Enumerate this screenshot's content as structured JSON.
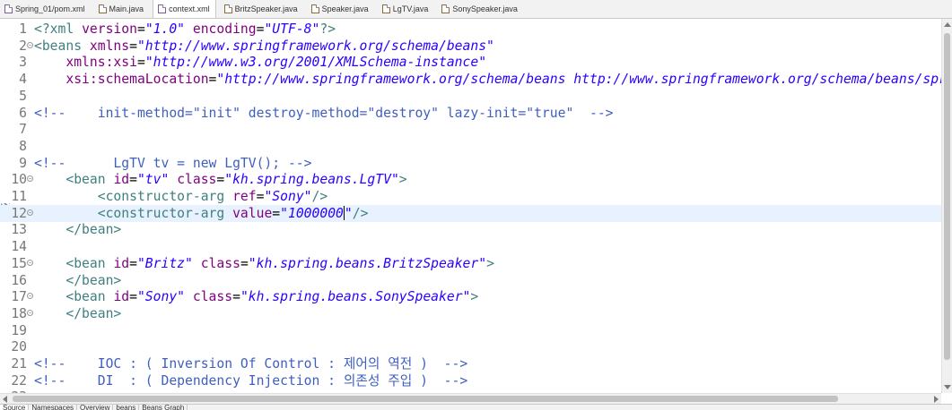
{
  "tabs": [
    {
      "label": "Spring_01/pom.xml",
      "type": "xml",
      "active": false
    },
    {
      "label": "Main.java",
      "type": "java",
      "active": false
    },
    {
      "label": "context.xml",
      "type": "xml",
      "active": true
    },
    {
      "label": "BritzSpeaker.java",
      "type": "java",
      "active": false
    },
    {
      "label": "Speaker.java",
      "type": "java",
      "active": false
    },
    {
      "label": "LgTV.java",
      "type": "java",
      "active": false
    },
    {
      "label": "SonySpeaker.java",
      "type": "java",
      "active": false
    }
  ],
  "editor": {
    "current_line": 12,
    "lines": [
      {
        "n": "1",
        "fold": false,
        "parts": [
          [
            "pi",
            "<?xml "
          ],
          [
            "attr",
            "version"
          ],
          [
            "plain",
            "="
          ],
          [
            "str",
            "\"1.0\""
          ],
          [
            "plain",
            " "
          ],
          [
            "attr",
            "encoding"
          ],
          [
            "plain",
            "="
          ],
          [
            "str",
            "\"UTF-8\""
          ],
          [
            "pi",
            "?>"
          ]
        ]
      },
      {
        "n": "2",
        "fold": true,
        "parts": [
          [
            "tag",
            "<beans "
          ],
          [
            "attr",
            "xmlns"
          ],
          [
            "plain",
            "="
          ],
          [
            "str",
            "\"http://www.springframework.org/schema/beans\""
          ]
        ]
      },
      {
        "n": "3",
        "fold": false,
        "parts": [
          [
            "plain",
            "    "
          ],
          [
            "attr",
            "xmlns:xsi"
          ],
          [
            "plain",
            "="
          ],
          [
            "str",
            "\"http://www.w3.org/2001/XMLSchema-instance\""
          ]
        ]
      },
      {
        "n": "4",
        "fold": false,
        "parts": [
          [
            "plain",
            "    "
          ],
          [
            "attr",
            "xsi:schemaLocation"
          ],
          [
            "plain",
            "="
          ],
          [
            "str",
            "\"http://www.springframework.org/schema/beans http://www.springframework.org/schema/beans/sprin"
          ]
        ]
      },
      {
        "n": "5",
        "fold": false,
        "parts": []
      },
      {
        "n": "6",
        "fold": false,
        "parts": [
          [
            "comment",
            "<!--    init-method=\"init\" destroy-method=\"destroy\" lazy-init=\"true\"  -->"
          ]
        ]
      },
      {
        "n": "7",
        "fold": false,
        "parts": []
      },
      {
        "n": "8",
        "fold": false,
        "parts": []
      },
      {
        "n": "9",
        "fold": false,
        "parts": [
          [
            "comment",
            "<!--      LgTV tv = new LgTV(); -->"
          ]
        ]
      },
      {
        "n": "10",
        "fold": true,
        "parts": [
          [
            "plain",
            "    "
          ],
          [
            "tag",
            "<bean "
          ],
          [
            "attr",
            "id"
          ],
          [
            "plain",
            "="
          ],
          [
            "str",
            "\"tv\""
          ],
          [
            "plain",
            " "
          ],
          [
            "attr",
            "class"
          ],
          [
            "plain",
            "="
          ],
          [
            "str",
            "\"kh.spring.beans.LgTV\""
          ],
          [
            "tag",
            ">"
          ]
        ]
      },
      {
        "n": "11",
        "fold": false,
        "parts": [
          [
            "plain",
            "        "
          ],
          [
            "tag",
            "<constructor-arg "
          ],
          [
            "attr",
            "ref"
          ],
          [
            "plain",
            "="
          ],
          [
            "str",
            "\"Sony\""
          ],
          [
            "tag",
            "/>"
          ]
        ]
      },
      {
        "n": "12",
        "fold": true,
        "parts": [
          [
            "plain",
            "        "
          ],
          [
            "tag",
            "<constructor-arg "
          ],
          [
            "attr",
            "value"
          ],
          [
            "plain",
            "="
          ],
          [
            "str",
            "\"1000000"
          ],
          [
            "caret",
            ""
          ],
          [
            "str",
            "\""
          ],
          [
            "tag",
            "/>"
          ]
        ]
      },
      {
        "n": "13",
        "fold": false,
        "parts": [
          [
            "plain",
            "    "
          ],
          [
            "tag",
            "</bean>"
          ]
        ]
      },
      {
        "n": "14",
        "fold": false,
        "parts": []
      },
      {
        "n": "15",
        "fold": true,
        "parts": [
          [
            "plain",
            "    "
          ],
          [
            "tag",
            "<bean "
          ],
          [
            "attr",
            "id"
          ],
          [
            "plain",
            "="
          ],
          [
            "str",
            "\"Britz\""
          ],
          [
            "plain",
            " "
          ],
          [
            "attr",
            "class"
          ],
          [
            "plain",
            "="
          ],
          [
            "str",
            "\"kh.spring.beans.BritzSpeaker\""
          ],
          [
            "tag",
            ">"
          ]
        ]
      },
      {
        "n": "16",
        "fold": false,
        "parts": [
          [
            "plain",
            "    "
          ],
          [
            "tag",
            "</bean>"
          ]
        ]
      },
      {
        "n": "17",
        "fold": true,
        "parts": [
          [
            "plain",
            "    "
          ],
          [
            "tag",
            "<bean "
          ],
          [
            "attr",
            "id"
          ],
          [
            "plain",
            "="
          ],
          [
            "str",
            "\"Sony\""
          ],
          [
            "plain",
            " "
          ],
          [
            "attr",
            "class"
          ],
          [
            "plain",
            "="
          ],
          [
            "str",
            "\"kh.spring.beans.SonySpeaker\""
          ],
          [
            "tag",
            ">"
          ]
        ]
      },
      {
        "n": "18",
        "fold": true,
        "parts": [
          [
            "plain",
            "    "
          ],
          [
            "tag",
            "</bean>"
          ]
        ]
      },
      {
        "n": "19",
        "fold": false,
        "parts": []
      },
      {
        "n": "20",
        "fold": false,
        "parts": []
      },
      {
        "n": "21",
        "fold": false,
        "parts": [
          [
            "comment",
            "<!--    IOC : ( Inversion Of Control : 제어의 역전 )  -->"
          ]
        ]
      },
      {
        "n": "22",
        "fold": false,
        "parts": [
          [
            "comment",
            "<!--    DI  : ( Dependency Injection : 의존성 주입 )  -->"
          ]
        ]
      },
      {
        "n": "23",
        "fold": false,
        "parts": []
      }
    ]
  },
  "bottom_tabs": [
    {
      "label": "Source",
      "active": true
    },
    {
      "label": "Namespaces",
      "active": false
    },
    {
      "label": "Overview",
      "active": false
    },
    {
      "label": "beans",
      "active": false
    },
    {
      "label": "Beans Graph",
      "active": false
    }
  ],
  "colors": {
    "comment": "#3f5fbf",
    "tag": "#3f7f7f",
    "attribute": "#7f007f",
    "string": "#2a00ff",
    "current_line": "#e8f2fe"
  }
}
